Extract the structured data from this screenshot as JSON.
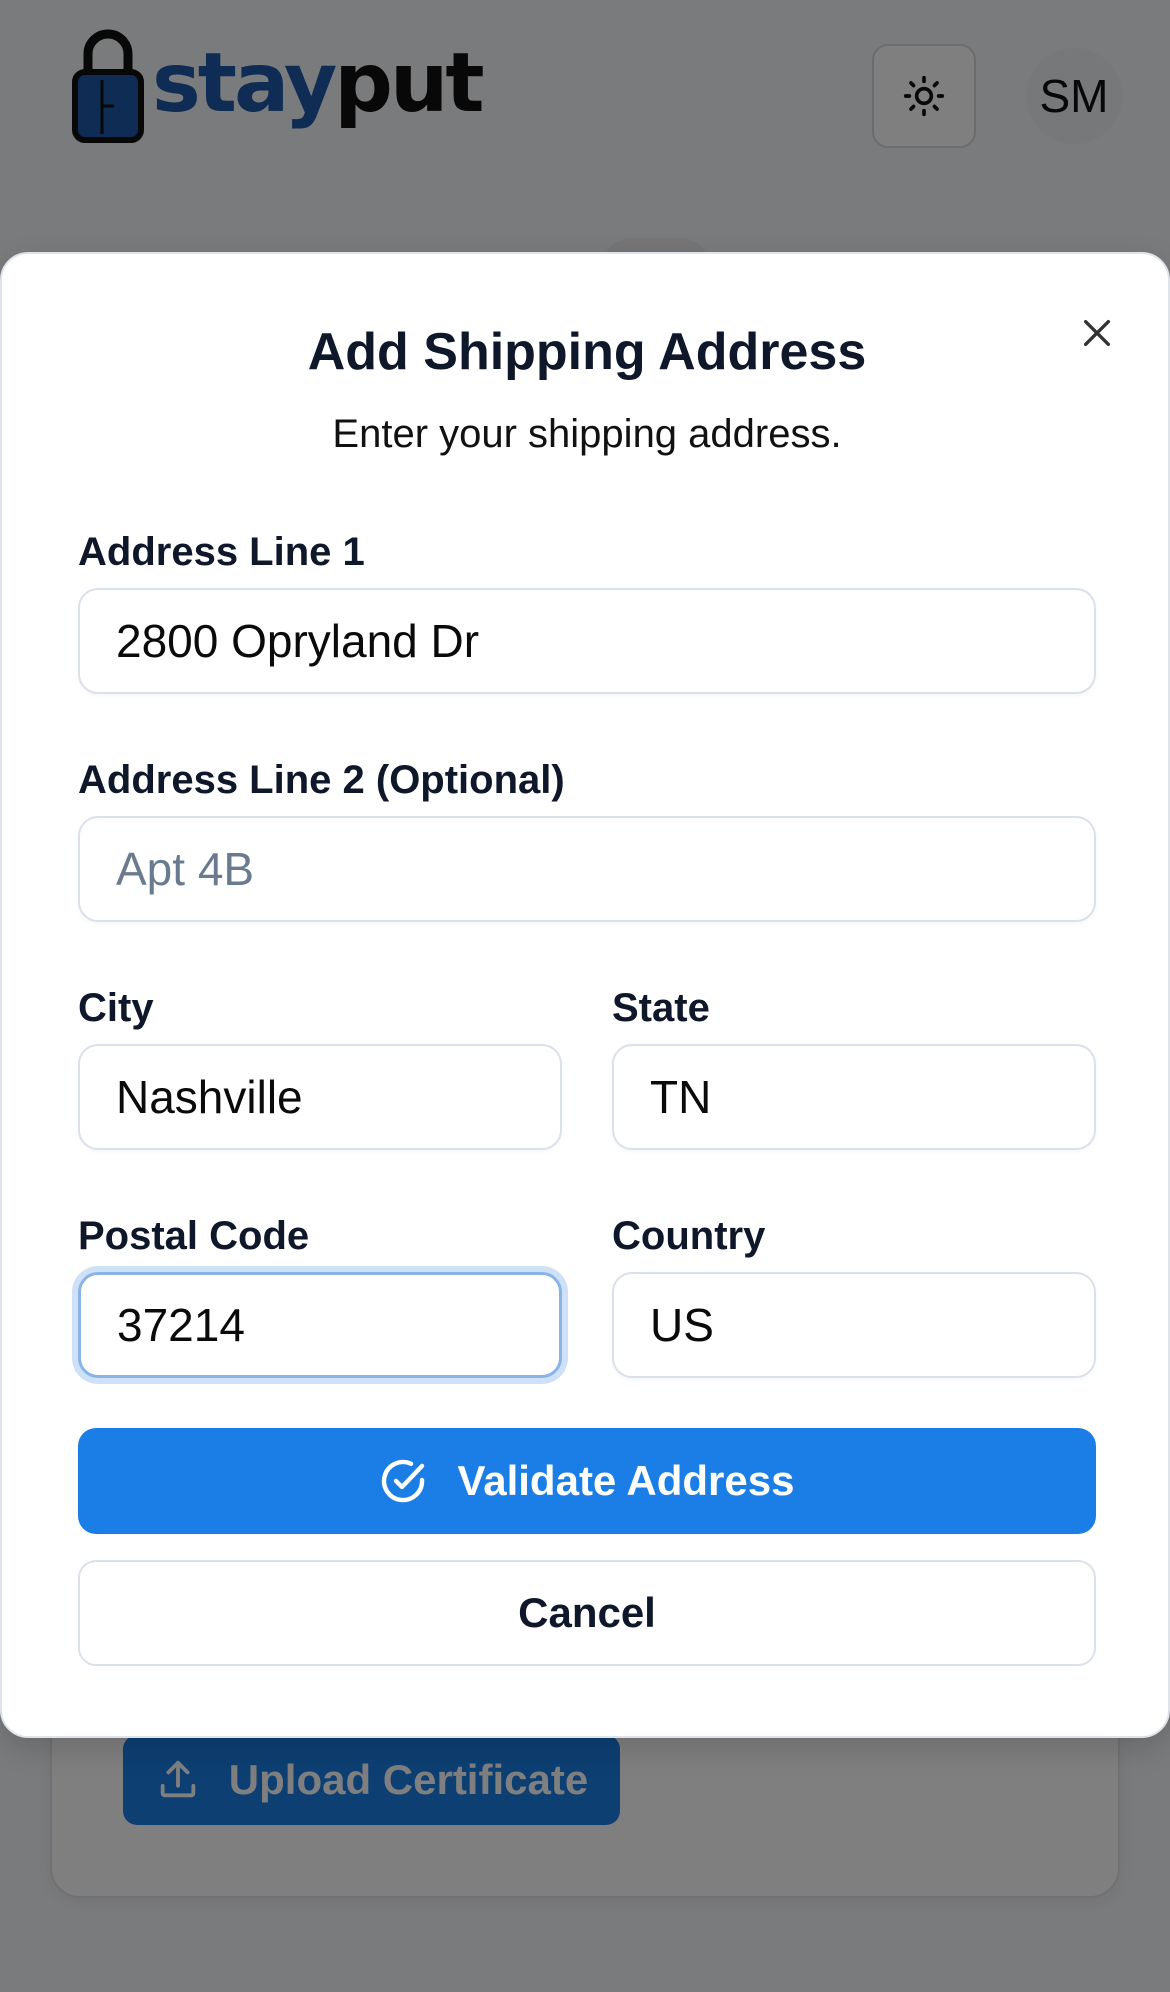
{
  "app": {
    "brand_part1": "stay",
    "brand_part2": "put",
    "avatar_initials": "SM",
    "icons": {
      "logo": "padlock-icon",
      "theme": "sun-icon"
    }
  },
  "background": {
    "upload_button_label": "Upload Certificate",
    "upload_icon": "upload-icon"
  },
  "modal": {
    "title": "Add Shipping Address",
    "subtitle": "Enter your shipping address.",
    "close_icon": "close-icon",
    "fields": {
      "address_line1": {
        "label": "Address Line 1",
        "value": "2800 Opryland Dr",
        "placeholder": ""
      },
      "address_line2": {
        "label": "Address Line 2 (Optional)",
        "value": "",
        "placeholder": "Apt 4B"
      },
      "city": {
        "label": "City",
        "value": "Nashville",
        "placeholder": ""
      },
      "state": {
        "label": "State",
        "value": "TN",
        "placeholder": ""
      },
      "postal_code": {
        "label": "Postal Code",
        "value": "37214",
        "placeholder": ""
      },
      "country": {
        "label": "Country",
        "value": "US",
        "placeholder": ""
      }
    },
    "validate_label": "Validate Address",
    "validate_icon": "check-circle-icon",
    "cancel_label": "Cancel"
  },
  "colors": {
    "primary": "#1a7ee6",
    "brand_blue": "#1e58a8",
    "focus_ring": "#cfe1f7",
    "overlay": "rgba(0,0,0,0.5)"
  }
}
